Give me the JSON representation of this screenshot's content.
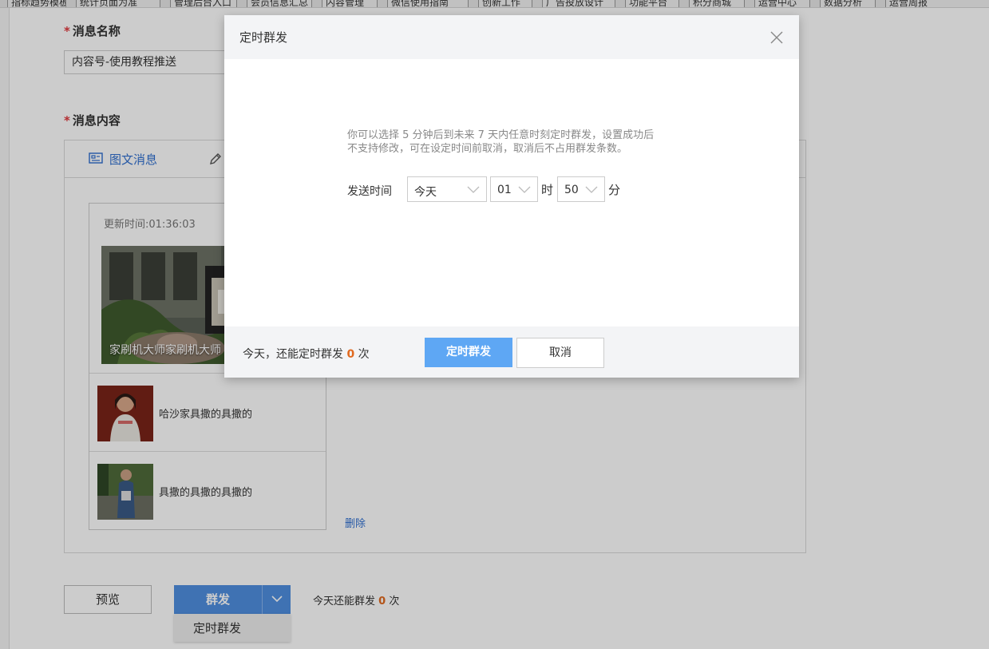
{
  "bookmarks": [
    "指标趋势模板",
    "统计页面为准",
    "管理后台入口",
    "会员信息汇总",
    "内容管理",
    "微信使用指南",
    "创新工作",
    "广告投放设计",
    "功能平台",
    "积分商城",
    "运营中心",
    "数据分析",
    "运营周报"
  ],
  "form": {
    "name_label": "消息名称",
    "name_value": "内容号-使用教程推送",
    "content_label": "消息内容",
    "required_mark": "*"
  },
  "content": {
    "tab_news_label": "图文消息",
    "update_time": "更新时间:01:36:03",
    "cover_title": "家刷机大师家刷机大师",
    "items": [
      {
        "title": "哈沙家具撒的具撒的"
      },
      {
        "title": "具撒的具撒的具撒的"
      }
    ],
    "delete_label": "删除"
  },
  "actions": {
    "preview_label": "预览",
    "send_label": "群发",
    "dropdown_item": "定时群发",
    "remaining_prefix": "今天还能群发",
    "remaining_count": "0",
    "remaining_suffix": "次"
  },
  "modal": {
    "title": "定时群发",
    "description_line1": "你可以选择 5 分钟后到未来 7 天内任意时刻定时群发，设置成功后",
    "description_line2": "不支持修改，可在设定时间前取消，取消后不占用群发条数。",
    "send_time_label": "发送时间",
    "day_value": "今天",
    "hour_value": "01",
    "hour_unit": "时",
    "minute_value": "50",
    "minute_unit": "分",
    "footer_prefix": "今天，还能定时群发",
    "footer_count": "0",
    "footer_suffix": "次",
    "confirm_label": "定时群发",
    "cancel_label": "取消"
  },
  "colors": {
    "accent": "#4f8fe0",
    "confirm": "#5ea7f4",
    "count": "#e0691f",
    "required": "#e0393e"
  },
  "icons": [
    "news-icon",
    "pencil-icon",
    "chevron-down-icon",
    "close-icon"
  ]
}
